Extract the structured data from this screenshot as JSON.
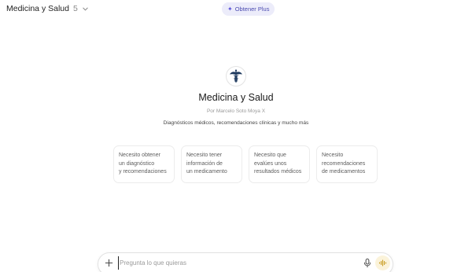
{
  "header": {
    "model_name": "Medicina y Salud",
    "model_version": "5",
    "upgrade_label": "Obtener Plus"
  },
  "gpt": {
    "title": "Medicina y Salud",
    "author": "Por Marcelo Soto Moya X",
    "description": "Diagnósticos médicos, recomendaciones clínicas y mucho más"
  },
  "suggestions": [
    {
      "line1": "Necesito obtener",
      "line2": "un diagnóstico",
      "line3": "y recomendaciones"
    },
    {
      "line1": "Necesito tener",
      "line2": "información de",
      "line3": "un medicamento"
    },
    {
      "line1": "Necesito que",
      "line2": "evalúes unos",
      "line3": "resultados médicos"
    },
    {
      "line1": "Necesito",
      "line2": "recomendaciones",
      "line3": "de medicamentos"
    }
  ],
  "composer": {
    "placeholder": "Pregunta lo que quieras",
    "value": ""
  },
  "icons": {
    "model_chevron": "chevron-down-icon",
    "upgrade": "sparkle-icon",
    "gpt_avatar": "caduceus-icon",
    "attach": "plus-icon",
    "dictate": "microphone-icon",
    "voice": "voice-mode-icon"
  },
  "colors": {
    "accent_upgrade": "#5b53d8",
    "upgrade_bg": "#ececfa",
    "voice_bg": "#fbf3da",
    "voice_fg": "#c79a1c",
    "logo_navy": "#1f3a5f"
  }
}
